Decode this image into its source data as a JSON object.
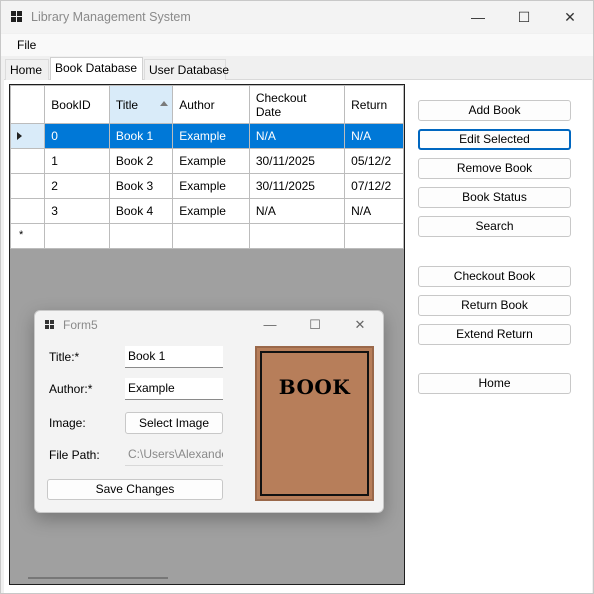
{
  "window": {
    "title": "Library Management System",
    "minimize_glyph": "—",
    "maximize_glyph": "☐",
    "close_glyph": "✕"
  },
  "menu": {
    "file_label": "File"
  },
  "tabs": [
    {
      "label": "Home"
    },
    {
      "label": "Book Database",
      "active": true
    },
    {
      "label": "User Database"
    }
  ],
  "grid": {
    "columns": [
      "BookID",
      "Title",
      "Author",
      "Checkout Date",
      "Return Date"
    ],
    "column_visible": [
      "BookID",
      "Title",
      "Author",
      "Checkout\nDate",
      "Return"
    ],
    "sorted_column": "Title",
    "new_row_marker": "*",
    "rows": [
      {
        "book_id": "0",
        "title": "Book 1",
        "author": "Example",
        "checkout": "N/A",
        "return": "N/A",
        "selected": true
      },
      {
        "book_id": "1",
        "title": "Book 2",
        "author": "Example",
        "checkout": "30/11/2025",
        "return": "05/12/2"
      },
      {
        "book_id": "2",
        "title": "Book 3",
        "author": "Example",
        "checkout": "30/11/2025",
        "return": "07/12/2"
      },
      {
        "book_id": "3",
        "title": "Book 4",
        "author": "Example",
        "checkout": "N/A",
        "return": "N/A"
      }
    ]
  },
  "actions": {
    "add_book": "Add Book",
    "edit_selected": "Edit Selected",
    "remove_book": "Remove Book",
    "book_status": "Book Status",
    "search": "Search",
    "checkout_book": "Checkout Book",
    "return_book": "Return Book",
    "extend_return": "Extend Return",
    "home": "Home"
  },
  "dialog": {
    "title": "Form5",
    "title_label": "Title:*",
    "title_value": "Book 1",
    "author_label": "Author:*",
    "author_value": "Example",
    "image_label": "Image:",
    "select_image": "Select Image",
    "file_path_label": "File Path:",
    "file_path_value": "C:\\Users\\Alexander",
    "save_changes": "Save Changes",
    "cover_text": "BOOK",
    "cover_color": "#b77e5a"
  },
  "colors": {
    "selection": "#0078d7",
    "focus_border": "#0067c0",
    "grid_background": "#a0a0a0"
  }
}
